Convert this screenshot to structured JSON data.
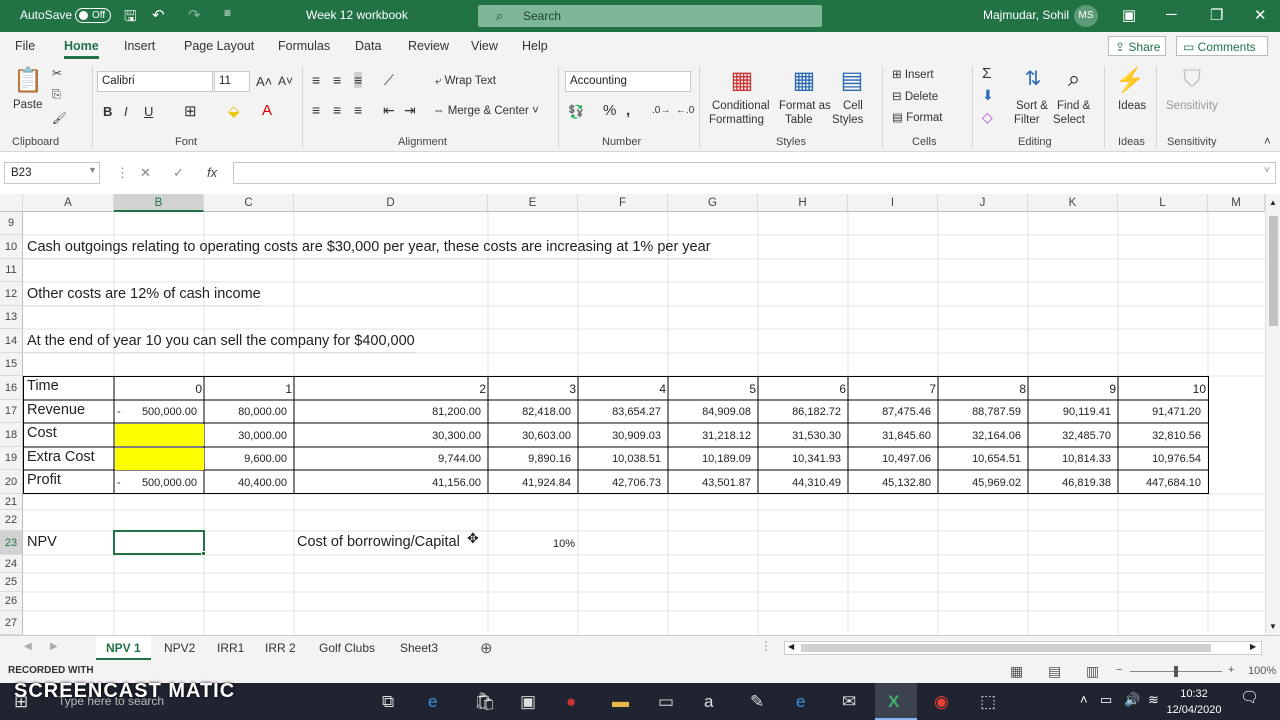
{
  "titlebar": {
    "autosave_label": "AutoSave",
    "autosave_state": "Off",
    "document_title": "Week 12 workbook",
    "search_placeholder": "Search",
    "user_name": "Majmudar, Sohil",
    "user_initials": "MS"
  },
  "menu": {
    "tabs": [
      "File",
      "Home",
      "Insert",
      "Page Layout",
      "Formulas",
      "Data",
      "Review",
      "View",
      "Help"
    ],
    "active_tab": "Home",
    "share_label": "Share",
    "comments_label": "Comments"
  },
  "ribbon": {
    "clipboard": {
      "paste": "Paste",
      "group": "Clipboard"
    },
    "font": {
      "name": "Calibri",
      "size": "11",
      "group": "Font"
    },
    "alignment": {
      "wrap_text": "Wrap Text",
      "merge_center": "Merge & Center",
      "group": "Alignment"
    },
    "number": {
      "format": "Accounting",
      "group": "Number"
    },
    "styles": {
      "conditional": "Conditional",
      "conditional2": "Formatting",
      "format_as": "Format as",
      "format_as2": "Table",
      "cell": "Cell",
      "cell2": "Styles",
      "group": "Styles"
    },
    "cells": {
      "insert": "Insert",
      "delete": "Delete",
      "format": "Format",
      "group": "Cells"
    },
    "editing": {
      "sort": "Sort &",
      "sort2": "Filter",
      "find": "Find &",
      "find2": "Select",
      "group": "Editing"
    },
    "ideas": {
      "label": "Ideas",
      "group": "Ideas"
    },
    "sensitivity": {
      "label": "Sensitivity",
      "group": "Sensitivity"
    }
  },
  "formula_bar": {
    "name_box": "B23",
    "fx": "fx",
    "content": ""
  },
  "columns": [
    "A",
    "B",
    "C",
    "D",
    "E",
    "F",
    "G",
    "H",
    "I",
    "J",
    "K",
    "L",
    "M"
  ],
  "rows": {
    "r9": "9",
    "r10": "10",
    "r11": "11",
    "r12": "12",
    "r13": "13",
    "r14": "14",
    "r15": "15",
    "r16": "16",
    "r17": "17",
    "r18": "18",
    "r19": "19",
    "r20": "20",
    "r21": "21",
    "r22": "22",
    "r23": "23",
    "r24": "24",
    "r25": "25",
    "r26": "26",
    "r27": "27"
  },
  "text": {
    "r10": "Cash outgoings relating to operating costs are $30,000 per year, these costs are increasing at 1% per year",
    "r12": "Other costs are 12% of cash income",
    "r14": "At the end of year 10 you can sell the company for $400,000"
  },
  "table": {
    "labels": [
      "Time",
      "Revenue",
      "Cost",
      "Extra Cost",
      "Profit"
    ],
    "time": [
      "0",
      "1",
      "2",
      "3",
      "4",
      "5",
      "6",
      "7",
      "8",
      "9",
      "10"
    ],
    "revenue": [
      "-",
      "500,000.00",
      "80,000.00",
      "81,200.00",
      "82,418.00",
      "83,654.27",
      "84,909.08",
      "86,182.72",
      "87,475.46",
      "88,787.59",
      "90,119.41",
      "91,471.20"
    ],
    "cost": [
      "30,000.00",
      "30,300.00",
      "30,603.00",
      "30,909.03",
      "31,218.12",
      "31,530.30",
      "31,845.60",
      "32,164.06",
      "32,485.70",
      "32,810.56"
    ],
    "extra": [
      "9,600.00",
      "9,744.00",
      "9,890.16",
      "10,038.51",
      "10,189.09",
      "10,341.93",
      "10,497.06",
      "10,654.51",
      "10,814.33",
      "10,976.54"
    ],
    "profit": [
      "-",
      "500,000.00",
      "40,400.00",
      "41,156.00",
      "41,924.84",
      "42,706.73",
      "43,501.87",
      "44,310.49",
      "45,132.80",
      "45,969.02",
      "46,819.38",
      "447,684.10"
    ]
  },
  "npv": {
    "label": "NPV",
    "rate_label": "Cost of borrowing/Capital",
    "rate_value": "10%"
  },
  "sheets": [
    "NPV 1",
    "NPV2",
    "IRR1",
    "IRR 2",
    "Golf Clubs",
    "Sheet3"
  ],
  "active_sheet": "NPV 1",
  "status": {
    "zoom": "100%"
  },
  "taskbar": {
    "search_placeholder": "Type here to search",
    "time": "10:32",
    "date": "12/04/2020"
  },
  "watermark": {
    "recorded": "RECORDED WITH",
    "brand": "SCREENCAST MATIC"
  },
  "colors": {
    "excel_green": "#217346",
    "yellow_fill": "#ffff00"
  }
}
